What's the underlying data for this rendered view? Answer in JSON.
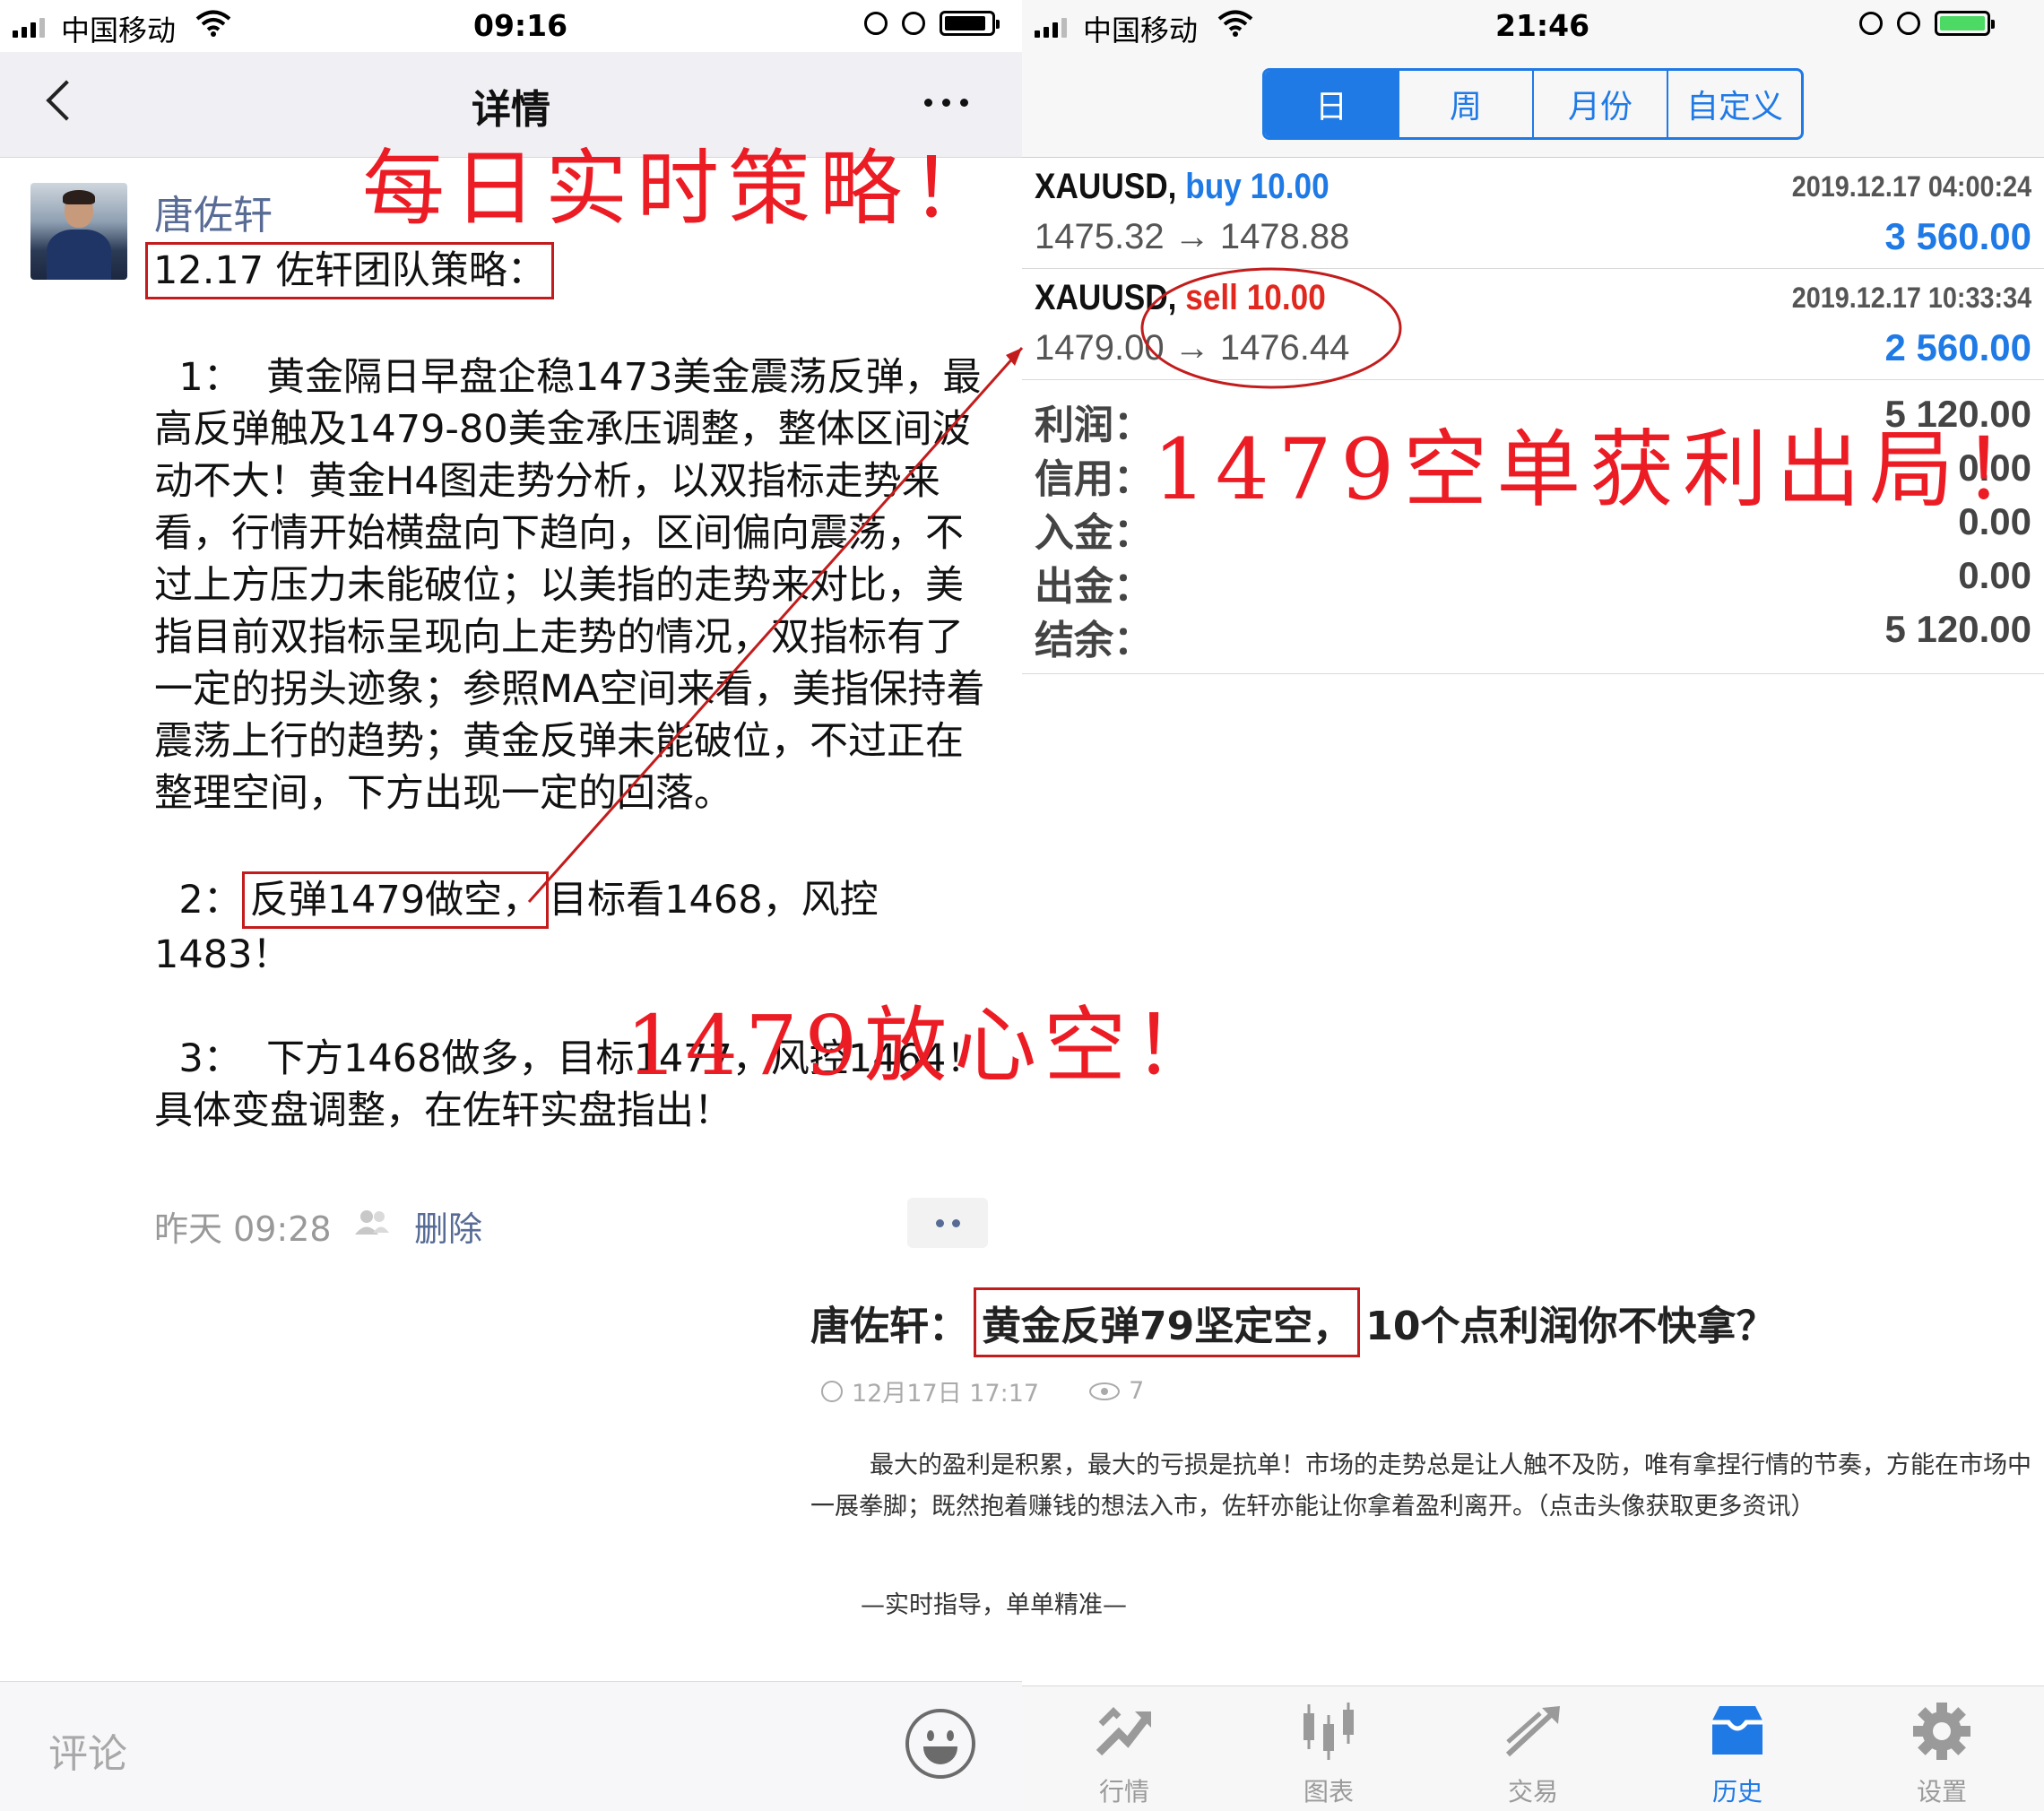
{
  "left_screen": {
    "status": {
      "carrier": "中国移动",
      "time": "09:16"
    },
    "nav": {
      "title": "详情"
    },
    "post": {
      "author": "唐佐轩",
      "heading": "12.17 佐轩团队策略：",
      "para1": "  1：  黄金隔日早盘企稳1473美金震荡反弹，最高反弹触及1479-80美金承压调整，整体区间波动不大！黄金H4图走势分析，以双指标走势来看，行情开始横盘向下趋向，区间偏向震荡，不过上方压力未能破位；以美指的走势来对比，美指目前双指标呈现向上走势的情况，双指标有了一定的拐头迹象；参照MA空间来看，美指保持着震荡上行的趋势；黄金反弹未能破位，不过正在整理空间，下方出现一定的回落。",
      "para2_prefix": "  2：",
      "para2_boxed": "反弹1479做空，",
      "para2_rest": "目标看1468，风控1483！",
      "para3": "  3：  下方1468做多，目标1477，风控1464！具体变盘调整，在佐轩实盘指出！",
      "timestamp": "昨天 09:28",
      "delete_label": "删除"
    },
    "comment": {
      "placeholder": "评论"
    }
  },
  "right_screen": {
    "status": {
      "carrier": "中国移动",
      "time": "21:46"
    },
    "period_tabs": [
      {
        "label": "日",
        "active": true
      },
      {
        "label": "周",
        "active": false
      },
      {
        "label": "月份",
        "active": false
      },
      {
        "label": "自定义",
        "active": false
      }
    ],
    "trades": [
      {
        "symbol": "XAUUSD,",
        "side": "buy 10.00",
        "datetime": "2019.12.17 04:00:24",
        "prices": "1475.32 → 1478.88",
        "profit": "3 560.00"
      },
      {
        "symbol": "XAUUSD,",
        "side": "sell 10.00",
        "datetime": "2019.12.17 10:33:34",
        "prices": "1479.00 → 1476.44",
        "profit": "2 560.00"
      }
    ],
    "summary": [
      {
        "label": "利润：",
        "value": "5 120.00"
      },
      {
        "label": "信用：",
        "value": "0.00"
      },
      {
        "label": "入金：",
        "value": "0.00"
      },
      {
        "label": "出金：",
        "value": "0.00"
      },
      {
        "label": "结余：",
        "value": "5 120.00"
      }
    ],
    "tabbar": [
      {
        "label": "行情",
        "icon": "quotes-icon",
        "active": false
      },
      {
        "label": "图表",
        "icon": "chart-icon",
        "active": false
      },
      {
        "label": "交易",
        "icon": "trade-icon",
        "active": false
      },
      {
        "label": "历史",
        "icon": "history-icon",
        "active": true
      },
      {
        "label": "设置",
        "icon": "settings-icon",
        "active": false
      }
    ]
  },
  "article": {
    "title_prefix": "唐佐轩：",
    "title_boxed": "黄金反弹79坚定空，",
    "title_rest": "10个点利润你不快拿？",
    "date": "12月17日 17:17",
    "views": "7",
    "body": "最大的盈利是积累，最大的亏损是抗单！市场的走势总是让人触不及防，唯有拿捏行情的节奏，方能在市场中一展拳脚；既然抱着赚钱的想法入市，佐轩亦能让你拿着盈利离开。（点击头像获取更多资讯）",
    "footer": "—实时指导，单单精准—"
  },
  "annotations": {
    "daily": "每日实时策略！",
    "profit": "1479空单获利出局！",
    "confident": "1479放心空！",
    "color": "#ec1c24"
  },
  "colors": {
    "accent": "#1f7ae6",
    "sell": "#e0281e",
    "link": "#576b95",
    "box": "#c31c1c",
    "battery_green": "#4cd964"
  }
}
